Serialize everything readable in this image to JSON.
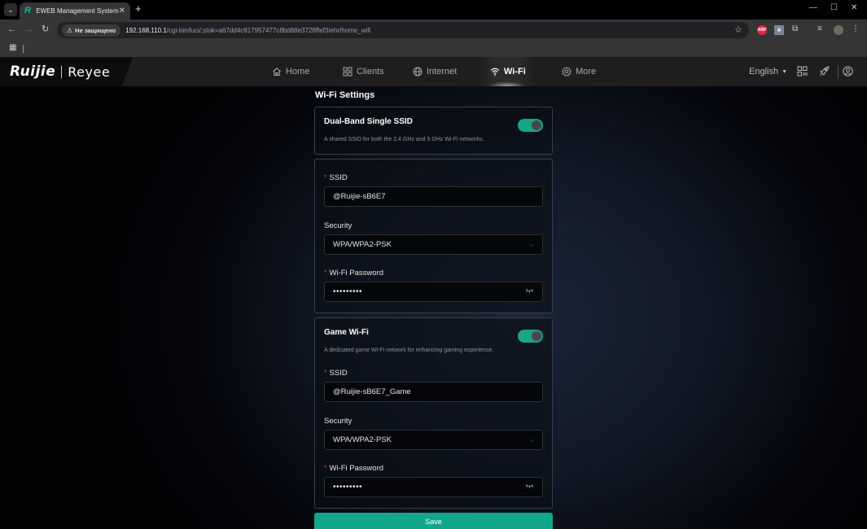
{
  "browser": {
    "tab_title": "EWEB Management System",
    "tab_favicon": "R",
    "security_chip": "Не защищено",
    "url_host": "192.168.110.1",
    "url_path": "/cgi-bin/luci/;stok=a67dd4c817957477c8bd88e3728ffef3/ehr/home_wifi",
    "extensions": [
      "ABP",
      "ext-grid",
      "puzzle-icon",
      "media-icon",
      "profile-avatar",
      "menu-icon"
    ]
  },
  "header": {
    "logo_brand": "Ruijie",
    "logo_sub": "Reyee",
    "nav": [
      {
        "label": "Home",
        "icon": "home-icon"
      },
      {
        "label": "Clients",
        "icon": "grid-icon"
      },
      {
        "label": "Internet",
        "icon": "globe-icon"
      },
      {
        "label": "Wi-Fi",
        "icon": "wifi-icon",
        "active": true
      },
      {
        "label": "More",
        "icon": "gear-icon"
      }
    ],
    "language": "English"
  },
  "page": {
    "title": "Wi-Fi Settings",
    "dual_band": {
      "title": "Dual-Band Single SSID",
      "description": "A shared SSID for both the 2.4 GHz and 5 GHz Wi-Fi networks.",
      "enabled": true
    },
    "main_wifi": {
      "ssid_label": "SSID",
      "ssid_value": "@Ruijie-sB6E7",
      "security_label": "Security",
      "security_value": "WPA/WPA2-PSK",
      "password_label": "Wi-Fi Password",
      "password_value": "•••••••••"
    },
    "game_wifi": {
      "title": "Game Wi-Fi",
      "description": "A dedicated game Wi-Fi network for enhancing gaming experience.",
      "enabled": true,
      "ssid_label": "SSID",
      "ssid_value": "@Ruijie-sB6E7_Game",
      "security_label": "Security",
      "security_value": "WPA/WPA2-PSK",
      "password_label": "Wi-Fi Password",
      "password_value": "•••••••••"
    },
    "save_label": "Save"
  },
  "colors": {
    "accent": "#12a68b",
    "required": "#e0413b"
  }
}
